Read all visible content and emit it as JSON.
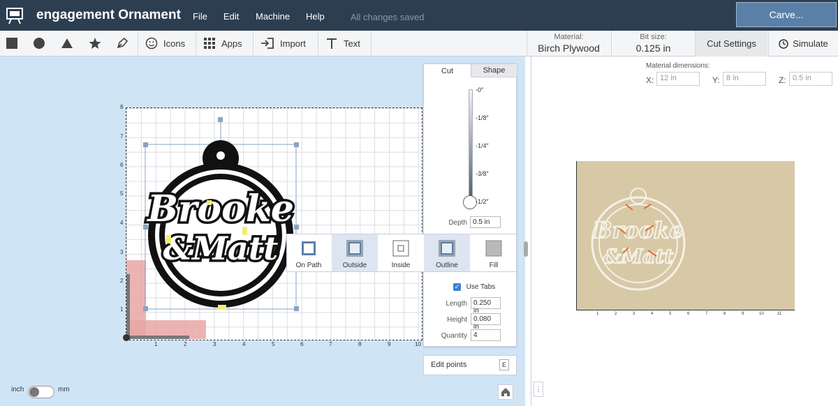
{
  "app": {
    "title": "engagement Ornament",
    "menu": [
      "File",
      "Edit",
      "Machine",
      "Help"
    ],
    "status": "All changes saved",
    "carve_label": "Carve..."
  },
  "toolbar": {
    "icons_label": "Icons",
    "apps_label": "Apps",
    "import_label": "Import",
    "text_label": "Text",
    "material_caption": "Material:",
    "material_value": "Birch Plywood",
    "bitsize_caption": "Bit size:",
    "bitsize_value": "0.125 in",
    "cut_settings_label": "Cut Settings",
    "simulate_label": "Simulate"
  },
  "canvas": {
    "y_ticks": [
      "8",
      "7",
      "6",
      "5",
      "4",
      "3",
      "2",
      "1"
    ],
    "x_ticks": [
      "1",
      "2",
      "3",
      "4",
      "5",
      "6",
      "7",
      "8",
      "9",
      "10"
    ],
    "design_text_line1": "Brooke",
    "design_text_line2": "&Matt"
  },
  "cut_panel": {
    "tab_cut": "Cut",
    "tab_shape": "Shape",
    "depth_ticks": [
      "-0″",
      "-1/8″",
      "-1/4″",
      "-3/8″",
      "-1/2″"
    ],
    "depth_label": "Depth",
    "depth_value": "0.5 in",
    "modes": [
      "On Path",
      "Outside",
      "Inside"
    ],
    "fill_modes": [
      "Outline",
      "Fill"
    ],
    "use_tabs_label": "Use Tabs",
    "length_label": "Length",
    "length_value": "0.250 in",
    "height_label": "Height",
    "height_value": "0.080 in",
    "quantity_label": "Quantity",
    "quantity_value": "4",
    "edit_points_label": "Edit points",
    "edit_points_key": "E"
  },
  "units": {
    "left": "inch",
    "right": "mm"
  },
  "preview": {
    "dims_caption": "Material dimensions:",
    "x_label": "X:",
    "x_value": "12 in",
    "y_label": "Y:",
    "y_value": "8 in",
    "z_label": "Z:",
    "z_value": "0.5 in",
    "x_ticks": [
      "1",
      "2",
      "3",
      "4",
      "5",
      "6",
      "7",
      "8",
      "9",
      "10",
      "11"
    ],
    "design_text_line1": "Brooke",
    "design_text_line2": "&Matt"
  },
  "colors": {
    "topbar": "#2d3e50",
    "carve_button": "#5b80a8",
    "canvas_bg": "#cfe5f6",
    "wood": "#d7c9a6",
    "cut_path": "#e86a2c"
  }
}
